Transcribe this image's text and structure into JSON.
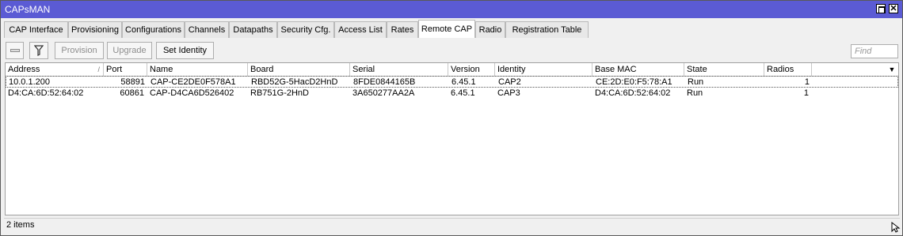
{
  "window": {
    "title": "CAPsMAN"
  },
  "tabs": [
    "CAP Interface",
    "Provisioning",
    "Configurations",
    "Channels",
    "Datapaths",
    "Security Cfg.",
    "Access List",
    "Rates",
    "Remote CAP",
    "Radio",
    "Registration Table"
  ],
  "active_tab": "Remote CAP",
  "toolbar": {
    "provision_label": "Provision",
    "upgrade_label": "Upgrade",
    "set_identity_label": "Set Identity",
    "find_placeholder": "Find"
  },
  "table": {
    "columns": [
      "Address",
      "Port",
      "Name",
      "Board",
      "Serial",
      "Version",
      "Identity",
      "Base MAC",
      "State",
      "Radios"
    ],
    "rows": [
      [
        "10.0.1.200",
        "58891",
        "CAP-CE2DE0F578A1",
        "RBD52G-5HacD2HnD",
        "8FDE0844165B",
        "6.45.1",
        "CAP2",
        "CE:2D:E0:F5:78:A1",
        "Run",
        "1"
      ],
      [
        "D4:CA:6D:52:64:02",
        "60861",
        "CAP-D4CA6D526402",
        "RB751G-2HnD",
        "3A650277AA2A",
        "6.45.1",
        "CAP3",
        "D4:CA:6D:52:64:02",
        "Run",
        "1"
      ]
    ]
  },
  "status": {
    "items_text": "2 items"
  },
  "colors": {
    "titlebar": "#5b5bd4",
    "window_bg": "#f0f0f0"
  }
}
